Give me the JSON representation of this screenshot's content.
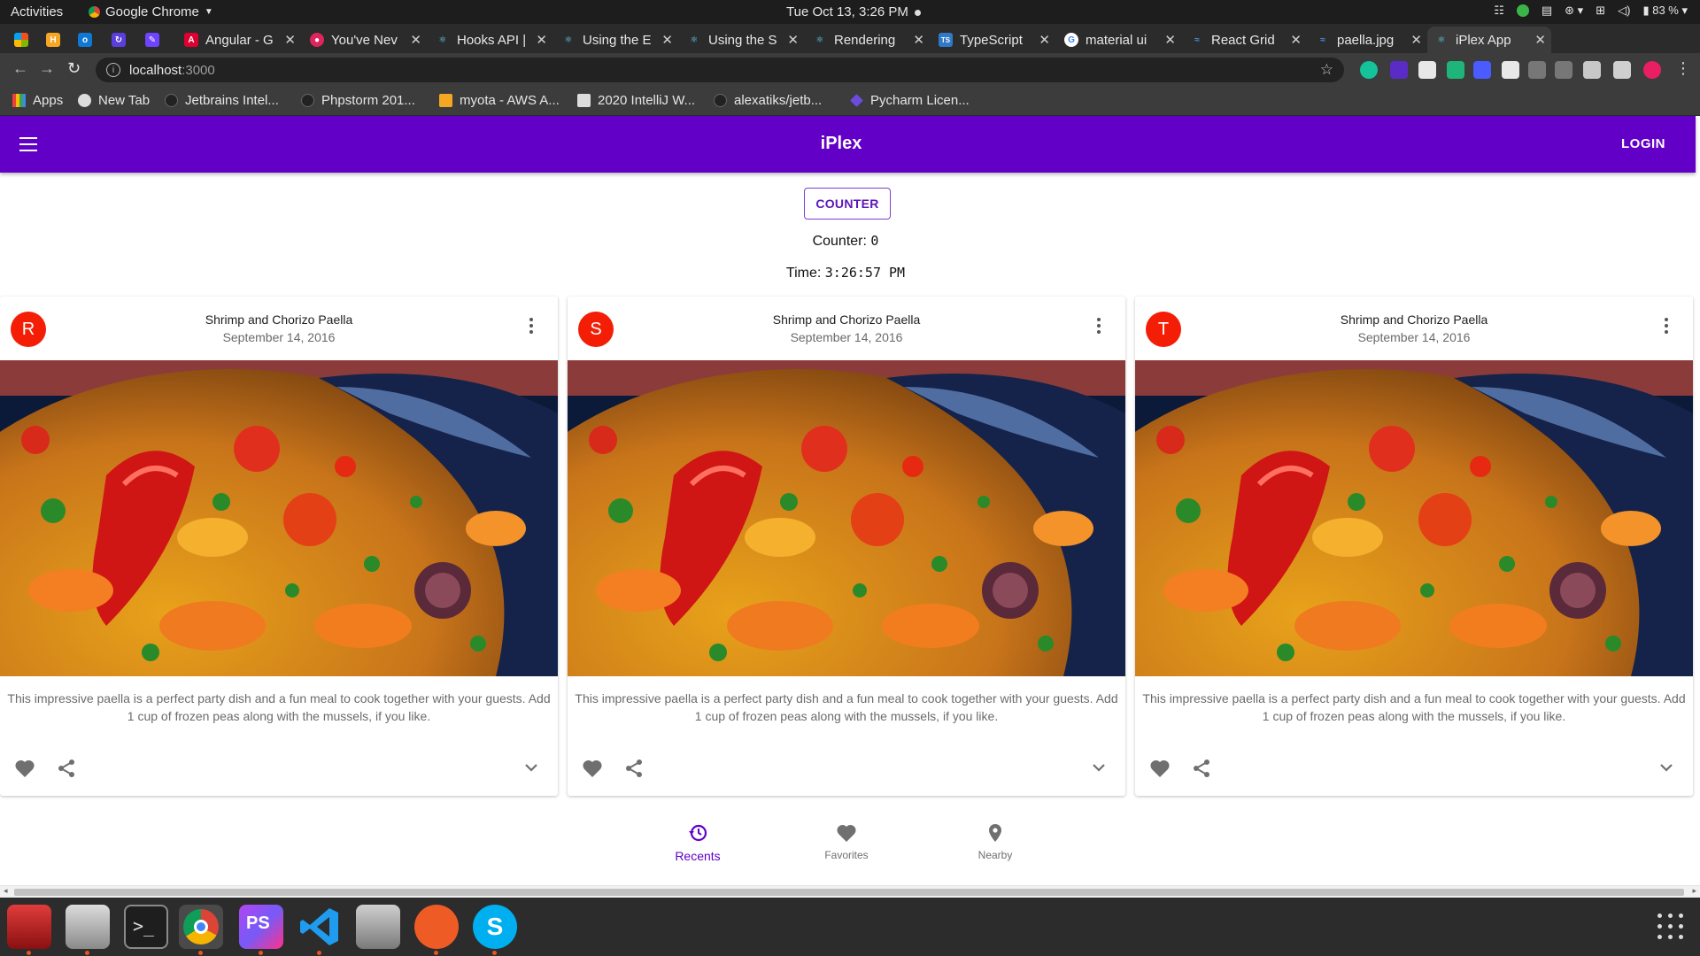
{
  "system": {
    "activities": "Activities",
    "app_name": "Google Chrome",
    "clock": "Tue Oct 13,  3:26 PM",
    "battery": "83 %"
  },
  "tabs": [
    {
      "title": "Angular - G",
      "favicon_color": "#dd0031"
    },
    {
      "title": "You've Nev",
      "favicon_color": "#e0245e"
    },
    {
      "title": "Hooks API |",
      "favicon_color": "#61dafb"
    },
    {
      "title": "Using the E",
      "favicon_color": "#61dafb"
    },
    {
      "title": "Using the S",
      "favicon_color": "#61dafb"
    },
    {
      "title": "Rendering",
      "favicon_color": "#61dafb"
    },
    {
      "title": "TypeScript",
      "favicon_color": "#3178c6"
    },
    {
      "title": "material ui",
      "favicon_color": "#4285f4"
    },
    {
      "title": "React Grid",
      "favicon_color": "#4a90e2"
    },
    {
      "title": "paella.jpg",
      "favicon_color": "#4a90e2"
    },
    {
      "title": "iPlex App",
      "favicon_color": "#61dafb",
      "active": true
    }
  ],
  "address_bar": {
    "host": "localhost",
    "port": ":3000"
  },
  "bookmarks": [
    {
      "label": "Apps",
      "icon": "apps-grid-icon"
    },
    {
      "label": "New Tab",
      "icon": "globe-icon"
    },
    {
      "label": "Jetbrains Intel...",
      "icon": "github-icon"
    },
    {
      "label": "Phpstorm 201...",
      "icon": "github-icon"
    },
    {
      "label": "myota - AWS A...",
      "icon": "box-icon"
    },
    {
      "label": "2020 IntelliJ W...",
      "icon": "page-icon"
    },
    {
      "label": "alexatiks/jetb...",
      "icon": "github-icon"
    },
    {
      "label": "Pycharm Licen...",
      "icon": "diamond-icon"
    }
  ],
  "app": {
    "title": "iPlex",
    "login_label": "LOGIN",
    "accent_color": "#6200c8",
    "counter_button": "COUNTER",
    "counter_label": "Counter:",
    "counter_value": "0",
    "time_label": "Time:",
    "time_value": "3:26:57 PM"
  },
  "cards": [
    {
      "avatar_letter": "R",
      "title": "Shrimp and Chorizo Paella",
      "subheader": "September 14, 2016",
      "body": "This impressive paella is a perfect party dish and a fun meal to cook together with your guests. Add 1 cup of frozen peas along with the mussels, if you like."
    },
    {
      "avatar_letter": "S",
      "title": "Shrimp and Chorizo Paella",
      "subheader": "September 14, 2016",
      "body": "This impressive paella is a perfect party dish and a fun meal to cook together with your guests. Add 1 cup of frozen peas along with the mussels, if you like."
    },
    {
      "avatar_letter": "T",
      "title": "Shrimp and Chorizo Paella",
      "subheader": "September 14, 2016",
      "body": "This impressive paella is a perfect party dish and a fun meal to cook together with your guests. Add 1 cup of frozen peas along with the mussels, if you like."
    }
  ],
  "bottom_nav": [
    {
      "label": "Recents",
      "icon": "history-icon",
      "active": true
    },
    {
      "label": "Favorites",
      "icon": "heart-icon",
      "active": false
    },
    {
      "label": "Nearby",
      "icon": "location-pin-icon",
      "active": false
    }
  ],
  "dock": [
    {
      "name": "screen-recorder"
    },
    {
      "name": "files"
    },
    {
      "name": "terminal"
    },
    {
      "name": "chrome",
      "selected": true
    },
    {
      "name": "phpstorm"
    },
    {
      "name": "vscode"
    },
    {
      "name": "camera"
    },
    {
      "name": "postman"
    },
    {
      "name": "skype"
    }
  ]
}
